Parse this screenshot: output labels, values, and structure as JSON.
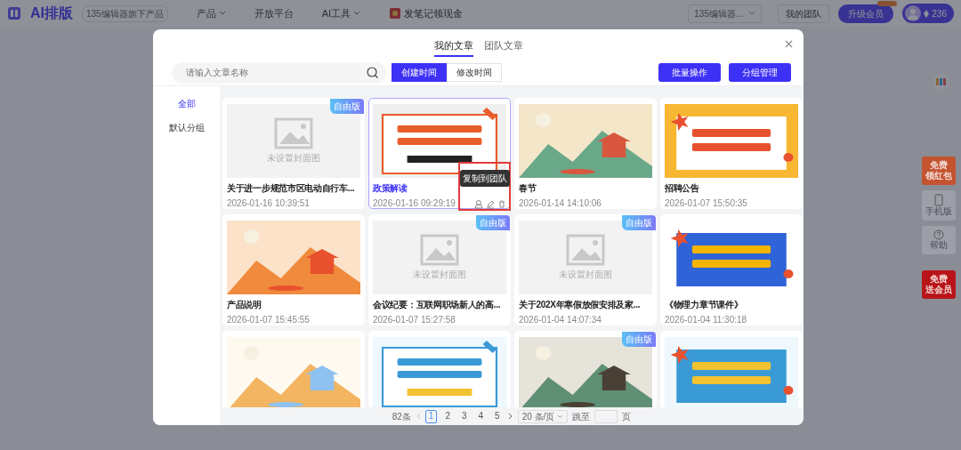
{
  "topbar": {
    "logo": "AI排版",
    "tagline": "135编辑器旗下产品",
    "nav": [
      {
        "label": "产品",
        "dropdown": true,
        "kind": "link"
      },
      {
        "label": "开放平台",
        "dropdown": false,
        "kind": "link"
      },
      {
        "label": "AI工具",
        "dropdown": true,
        "kind": "link"
      },
      {
        "label": "发笔记领现金",
        "kind": "promo"
      }
    ],
    "editor_select": "135编辑器...",
    "team": "我的团队",
    "upgrade": "升级会员",
    "points": "236"
  },
  "side_tools": [
    {
      "kind": "promo",
      "lines": [
        "免费",
        "领红包"
      ],
      "color": "#c4532f"
    },
    {
      "kind": "phone",
      "lines": [
        "手机版"
      ]
    },
    {
      "kind": "help",
      "lines": [
        "帮助"
      ]
    },
    {
      "kind": "promo",
      "lines": [
        "免费",
        "送会员"
      ],
      "color": "#b8141a"
    }
  ],
  "dialog": {
    "tabs": [
      {
        "label": "我的文章",
        "selected": true
      },
      {
        "label": "团队文章",
        "selected": false
      }
    ],
    "search": {
      "placeholder": "请输入文章名称"
    },
    "sort": [
      {
        "label": "创建时间",
        "selected": true
      },
      {
        "label": "修改时间",
        "selected": false
      }
    ],
    "actions": [
      "批量操作",
      "分组管理"
    ],
    "groups": [
      {
        "label": "全部",
        "selected": true
      },
      {
        "label": "默认分组",
        "selected": false
      }
    ],
    "articles": [
      {
        "cover": {
          "kind": "placeholder",
          "text": "未设置封面图"
        },
        "badge": "自由版",
        "title": "关于进一步规范市区电动自行车...",
        "date": "2026-01-16 10:39:51",
        "selected": false
      },
      {
        "title": "政策解读",
        "date": "2026-01-16 09:29:19",
        "selected": true,
        "hovered": true,
        "tooltip": "复制到团队",
        "highlighted": true
      },
      {
        "title": "春节",
        "date": "2026-01-14 14:10:06",
        "selected": false
      },
      {
        "title": "招聘公告",
        "date": "2026-01-07 15:50:35",
        "selected": false
      },
      {
        "title": "产品说明",
        "date": "2026-01-07 15:45:55",
        "selected": false
      },
      {
        "cover": {
          "kind": "placeholder",
          "text": "未设置封面图"
        },
        "badge": "自由版",
        "title": "会议纪要：互联网职场新人的高...",
        "date": "2026-01-07 15:27:58",
        "selected": false
      },
      {
        "cover": {
          "kind": "placeholder",
          "text": "未设置封面图"
        },
        "badge": "自由版",
        "title": "关于202X年寒假放假安排及家...",
        "date": "2026-01-04 14:07:34",
        "selected": false
      },
      {
        "title": "《物理力章节课件》",
        "date": "2026-01-04 11:30:18",
        "selected": false
      },
      {
        "selected": false
      },
      {
        "selected": false
      },
      {
        "badge": "自由版",
        "selected": false
      },
      {
        "selected": false
      }
    ],
    "pagination": {
      "total": "82条",
      "pages": [
        {
          "label": "1",
          "selected": true
        },
        {
          "label": "2",
          "selected": false
        },
        {
          "label": "3",
          "selected": false
        },
        {
          "label": "4",
          "selected": false
        },
        {
          "label": "5",
          "selected": false
        }
      ],
      "page_size": "20 条/页",
      "jump_label": "跳至",
      "page_unit": "页"
    }
  }
}
